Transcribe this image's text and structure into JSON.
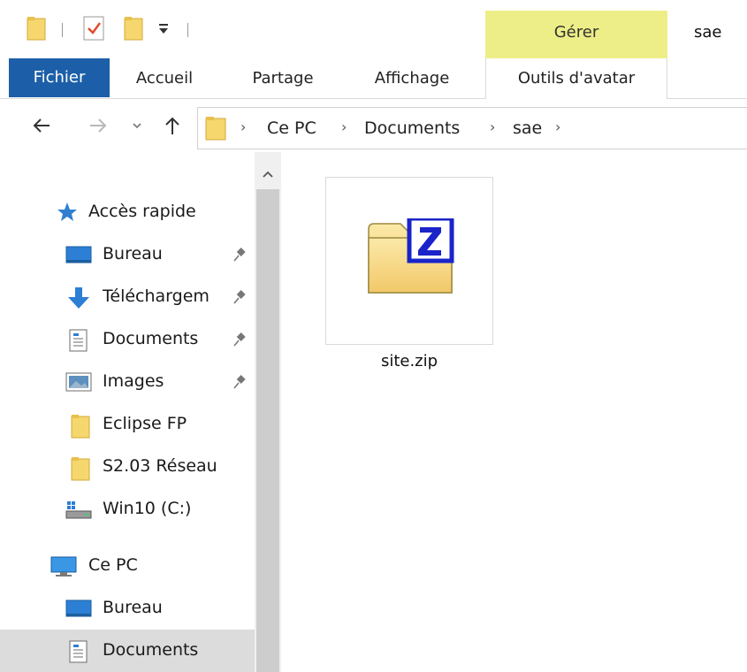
{
  "window": {
    "title": "sae",
    "context_group": "Gérer"
  },
  "ribbon": {
    "tabs": [
      {
        "label": "Fichier"
      },
      {
        "label": "Accueil"
      },
      {
        "label": "Partage"
      },
      {
        "label": "Affichage"
      },
      {
        "label": "Outils d'avatar"
      }
    ]
  },
  "address": {
    "crumbs": [
      "Ce PC",
      "Documents",
      "sae"
    ]
  },
  "nav": {
    "quick_access": "Accès rapide",
    "items": [
      {
        "label": "Bureau",
        "icon": "desktop-icon",
        "pinned": true
      },
      {
        "label": "Téléchargem",
        "icon": "download-icon",
        "pinned": true
      },
      {
        "label": "Documents",
        "icon": "document-icon",
        "pinned": true
      },
      {
        "label": "Images",
        "icon": "picture-icon",
        "pinned": true
      },
      {
        "label": "Eclipse FP",
        "icon": "folder-icon",
        "pinned": false
      },
      {
        "label": "S2.03 Réseau",
        "icon": "folder-icon",
        "pinned": false
      },
      {
        "label": "Win10 (C:)",
        "icon": "drive-icon",
        "pinned": false
      }
    ],
    "this_pc": "Ce PC",
    "pc_items": [
      {
        "label": "Bureau",
        "icon": "desktop-icon"
      },
      {
        "label": "Documents",
        "icon": "document-icon",
        "selected": true
      }
    ]
  },
  "content": {
    "files": [
      {
        "name": "site.zip",
        "icon": "zip-archive-icon"
      }
    ]
  },
  "colors": {
    "file_tab": "#1c5fa8",
    "manage_band": "#eeee88",
    "folder": "#f5d76e",
    "selected_row": "#dcdcdc"
  }
}
